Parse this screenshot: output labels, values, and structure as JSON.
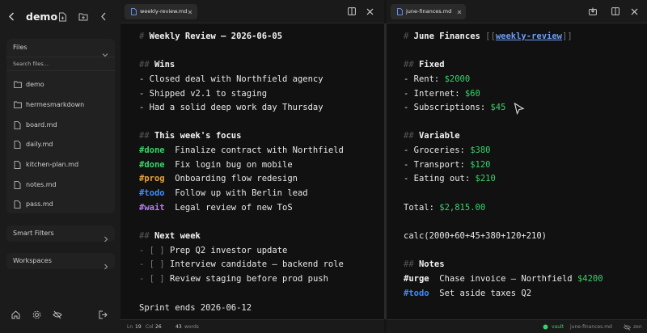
{
  "sidebar": {
    "vault_title": "demo",
    "files_header": "Files",
    "search_placeholder": "Search files...",
    "items": [
      {
        "label": "demo",
        "kind": "folder"
      },
      {
        "label": "hermesmarkdown",
        "kind": "folder"
      },
      {
        "label": "board.md",
        "kind": "file"
      },
      {
        "label": "daily.md",
        "kind": "file"
      },
      {
        "label": "kitchen-plan.md",
        "kind": "file"
      },
      {
        "label": "notes.md",
        "kind": "file"
      },
      {
        "label": "pass.md",
        "kind": "file"
      }
    ],
    "smart_filters": "Smart Filters",
    "workspaces": "Workspaces"
  },
  "left_pane": {
    "tab": "weekly-review.md",
    "lines": {
      "title_hash": "# ",
      "title": "Weekly Review — 2026-06-05",
      "wins_hash": "## ",
      "wins": "Wins",
      "w1": "- Closed deal with Northfield agency",
      "w2": "- Shipped v2.1 to staging",
      "w3": "- Had a solid deep work day Thursday",
      "focus_hash": "## ",
      "focus": "This week's focus",
      "f1_tag": "#done",
      "f1": "  Finalize contract with Northfield",
      "f2_tag": "#done",
      "f2": "  Fix login bug on mobile",
      "f3_tag": "#prog",
      "f3": "  Onboarding flow redesign",
      "f4_tag": "#todo",
      "f4": "  Follow up with Berlin lead",
      "f5_tag": "#wait",
      "f5": "  Legal review of new ToS",
      "next_hash": "## ",
      "next": "Next week",
      "n1_pre": "- [ ] ",
      "n1": "Prep Q2 investor update",
      "n2_pre": "- [ ] ",
      "n2": "Interview candidate — backend role",
      "n3_pre": "- [ ] ",
      "n3": "Review staging before prod push",
      "sprint": "Sprint ends 2026-06-12"
    },
    "status": {
      "ln_label": "Ln",
      "ln": "19",
      "col_label": "Col",
      "col": "26",
      "words": "43",
      "words_label": "words"
    }
  },
  "right_pane": {
    "tab": "june-finances.md",
    "lines": {
      "title_hash": "# ",
      "title": "June Finances ",
      "link_open": "[[",
      "link": "weekly-review",
      "link_close": "]]",
      "fixed_hash": "## ",
      "fixed": "Fixed",
      "r1": "- Rent: ",
      "r1v": "$2000",
      "r2": "- Internet: ",
      "r2v": "$60",
      "r3": "- Subscriptions: ",
      "r3v": "$45",
      "var_hash": "## ",
      "var": "Variable",
      "v1": "- Groceries: ",
      "v1v": "$380",
      "v2": "- Transport: ",
      "v2v": "$120",
      "v3": "- Eating out: ",
      "v3v": "$210",
      "total": "Total: ",
      "totalv": "$2,815.00",
      "calc": "calc(2000+60+45+380+120+210)",
      "notes_hash": "## ",
      "notes": "Notes",
      "nt1_tag": "#urge",
      "nt1": "  Chase invoice — Northfield ",
      "nt1v": "$4200",
      "nt2_tag": "#todo",
      "nt2": "  Set aside taxes Q2"
    },
    "status": {
      "vault": "vault",
      "file": "june-finances.md",
      "zen": "zen"
    }
  },
  "colors": {
    "green": "#38d26b",
    "orange": "#e8a33b",
    "blue": "#3d8cff",
    "purple": "#b87cf0"
  }
}
